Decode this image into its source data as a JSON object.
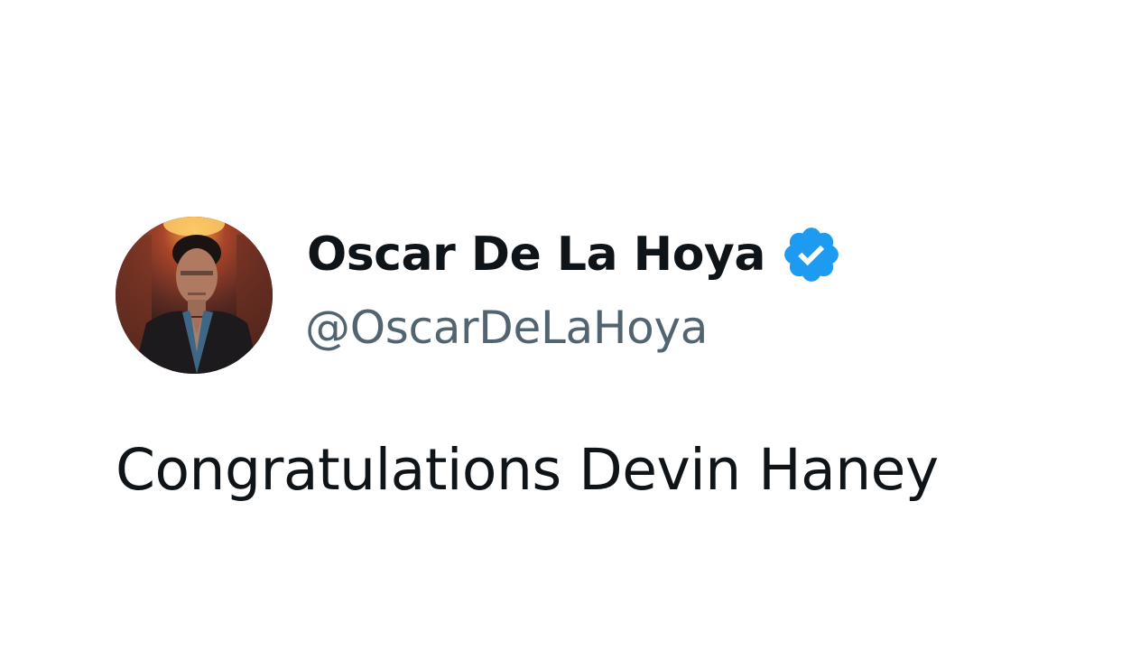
{
  "tweet": {
    "author": {
      "display_name": "Oscar De La Hoya",
      "handle": "@OscarDeLaHoya",
      "verified": true,
      "verified_icon": "verified-badge-icon",
      "verified_color": "#1d9bf0"
    },
    "text": "Congratulations Devin Haney"
  },
  "colors": {
    "name": "#0f1419",
    "handle": "#536471",
    "background": "#ffffff"
  }
}
